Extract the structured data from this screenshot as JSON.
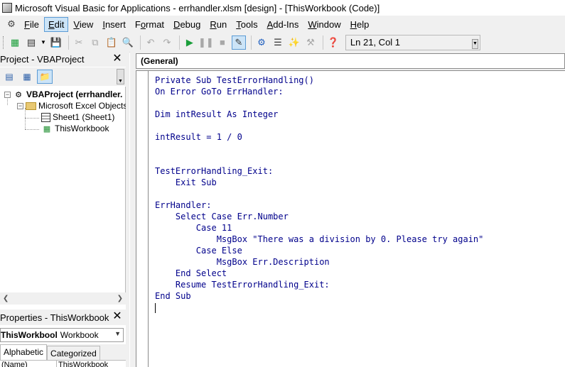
{
  "window": {
    "title": "Microsoft Visual Basic for Applications - errhandler.xlsm [design] - [ThisWorkbook (Code)]"
  },
  "menu": [
    {
      "pre": "",
      "u": "F",
      "post": "ile"
    },
    {
      "pre": "",
      "u": "E",
      "post": "dit"
    },
    {
      "pre": "",
      "u": "V",
      "post": "iew"
    },
    {
      "pre": "",
      "u": "I",
      "post": "nsert"
    },
    {
      "pre": "F",
      "u": "o",
      "post": "rmat"
    },
    {
      "pre": "",
      "u": "D",
      "post": "ebug"
    },
    {
      "pre": "",
      "u": "R",
      "post": "un"
    },
    {
      "pre": "",
      "u": "T",
      "post": "ools"
    },
    {
      "pre": "",
      "u": "A",
      "post": "dd-Ins"
    },
    {
      "pre": "",
      "u": "W",
      "post": "indow"
    },
    {
      "pre": "",
      "u": "H",
      "post": "elp"
    }
  ],
  "menu_active_index": 1,
  "toolbar": {
    "cursor_position": "Ln 21, Col 1"
  },
  "project_pane": {
    "title": "Project - VBAProject",
    "tree": {
      "root": "VBAProject (errhandler.",
      "folder": "Microsoft Excel Objects",
      "sheet": "Sheet1 (Sheet1)",
      "workbook": "ThisWorkbook"
    }
  },
  "properties_pane": {
    "title": "Properties - ThisWorkbook",
    "object_name": "ThisWorkbool",
    "object_type": "Workbook",
    "tabs": [
      "Alphabetic",
      "Categorized"
    ],
    "grid_name": "(Name)",
    "grid_value": "ThisWorkbook"
  },
  "code_window": {
    "object_selector": "(General)",
    "lines": [
      [
        {
          "t": "Private Sub ",
          "k": "kw"
        },
        {
          "t": "TestErrorHandling()",
          "k": "kw"
        }
      ],
      [
        {
          "t": "On Error GoTo ErrHandler:",
          "k": "kw"
        }
      ],
      [],
      [
        {
          "t": "Dim intResult As Integer",
          "k": "kw"
        }
      ],
      [],
      [
        {
          "t": "intResult = 1 / 0",
          "k": "kw"
        }
      ],
      [],
      [],
      [
        {
          "t": "TestErrorHandling_Exit:",
          "k": "kw"
        }
      ],
      [
        {
          "t": "    Exit Sub",
          "k": "kw"
        }
      ],
      [],
      [
        {
          "t": "ErrHandler:",
          "k": "kw"
        }
      ],
      [
        {
          "t": "    Select Case Err.Number",
          "k": "kw"
        }
      ],
      [
        {
          "t": "        Case 11",
          "k": "kw"
        }
      ],
      [
        {
          "t": "            MsgBox \"There was a division by 0. Please try again\"",
          "k": "kw"
        }
      ],
      [
        {
          "t": "        Case Else",
          "k": "kw"
        }
      ],
      [
        {
          "t": "            MsgBox Err.Description",
          "k": "kw"
        }
      ],
      [
        {
          "t": "    End Select",
          "k": "kw"
        }
      ],
      [
        {
          "t": "    Resume TestErrorHandling_Exit:",
          "k": "kw"
        }
      ],
      [
        {
          "t": "End Sub",
          "k": "kw"
        }
      ],
      []
    ]
  },
  "icons": {
    "app": "vba-app-icon",
    "excel": "excel-icon",
    "save": "save-icon",
    "run": "run-icon",
    "pause": "break-icon",
    "stop": "reset-icon",
    "design": "design-mode-icon",
    "help": "help-icon"
  }
}
